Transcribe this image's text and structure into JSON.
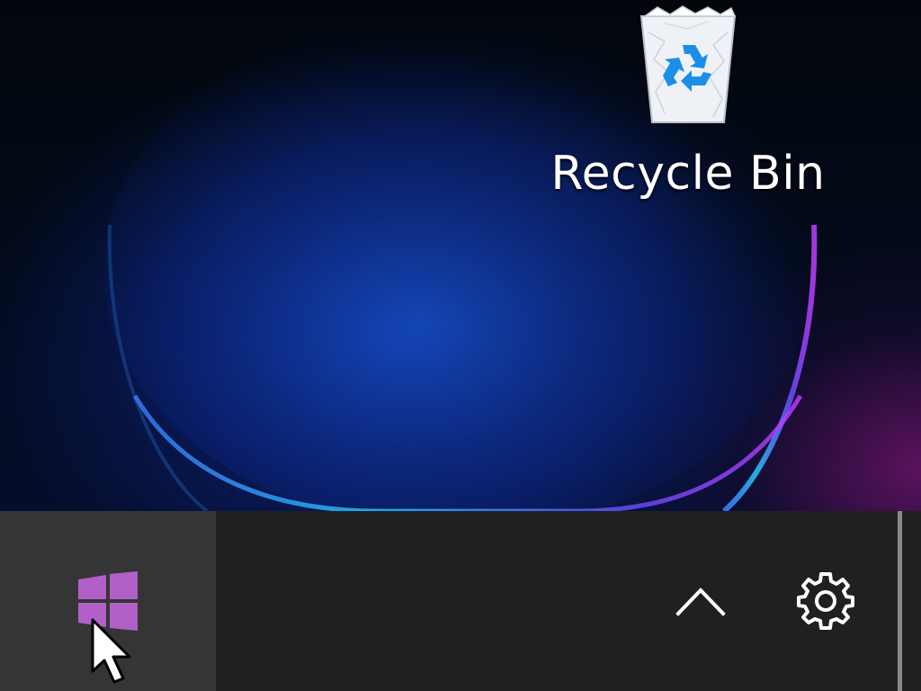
{
  "desktop": {
    "recycle_bin": {
      "label": "Recycle Bin",
      "icon": "recycle-bin-icon"
    }
  },
  "taskbar": {
    "start": {
      "icon": "windows-logo-icon",
      "color": "#b15fc9"
    },
    "tray_overflow": {
      "icon": "chevron-up-icon"
    },
    "settings": {
      "icon": "gear-icon"
    }
  },
  "cursor": {
    "icon": "mouse-pointer-icon"
  }
}
